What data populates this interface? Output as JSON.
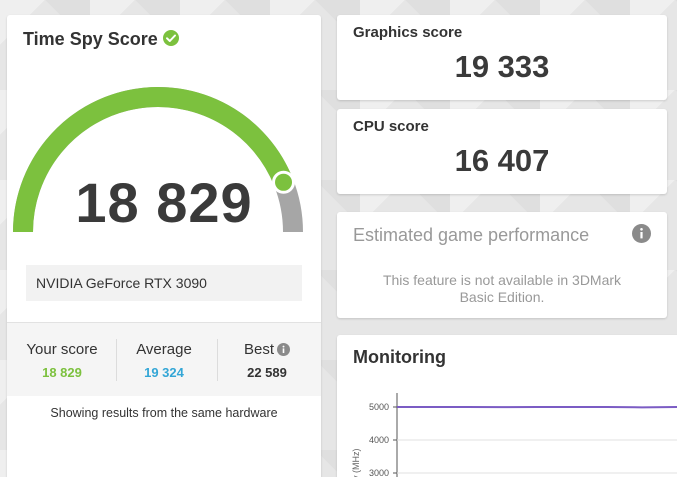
{
  "main": {
    "title": "Time Spy Score",
    "score": "18 829",
    "gpu_name": "NVIDIA GeForce RTX 3090",
    "gauge_fill_fraction": 0.88,
    "stats": {
      "your_label": "Your score",
      "your_value": "18 829",
      "avg_label": "Average",
      "avg_value": "19 324",
      "best_label": "Best",
      "best_value": "22 589"
    },
    "footnote": "Showing results from the same hardware"
  },
  "graphics": {
    "title": "Graphics score",
    "value": "19 333"
  },
  "cpu": {
    "title": "CPU score",
    "value": "16 407"
  },
  "estimated": {
    "title": "Estimated game performance",
    "message_line1": "This feature is not available in 3DMark",
    "message_line2": "Basic Edition."
  },
  "monitoring": {
    "title": "Monitoring",
    "ylabel": "y (MHz)",
    "chart_data": {
      "type": "line",
      "title": "",
      "xlabel": "",
      "ylabel": "y (MHz)",
      "y_ticks": [
        "5000",
        "4000",
        "3000"
      ],
      "series": [
        {
          "values": [
            5000,
            5000,
            5000,
            4995,
            5000,
            5000,
            5000,
            4990,
            5000
          ]
        }
      ]
    }
  },
  "colors": {
    "gauge_green": "#7cc13e",
    "gauge_gray": "#a6a6a6",
    "average_blue": "#33a6d6",
    "line_purple": "#7b5cc4"
  }
}
